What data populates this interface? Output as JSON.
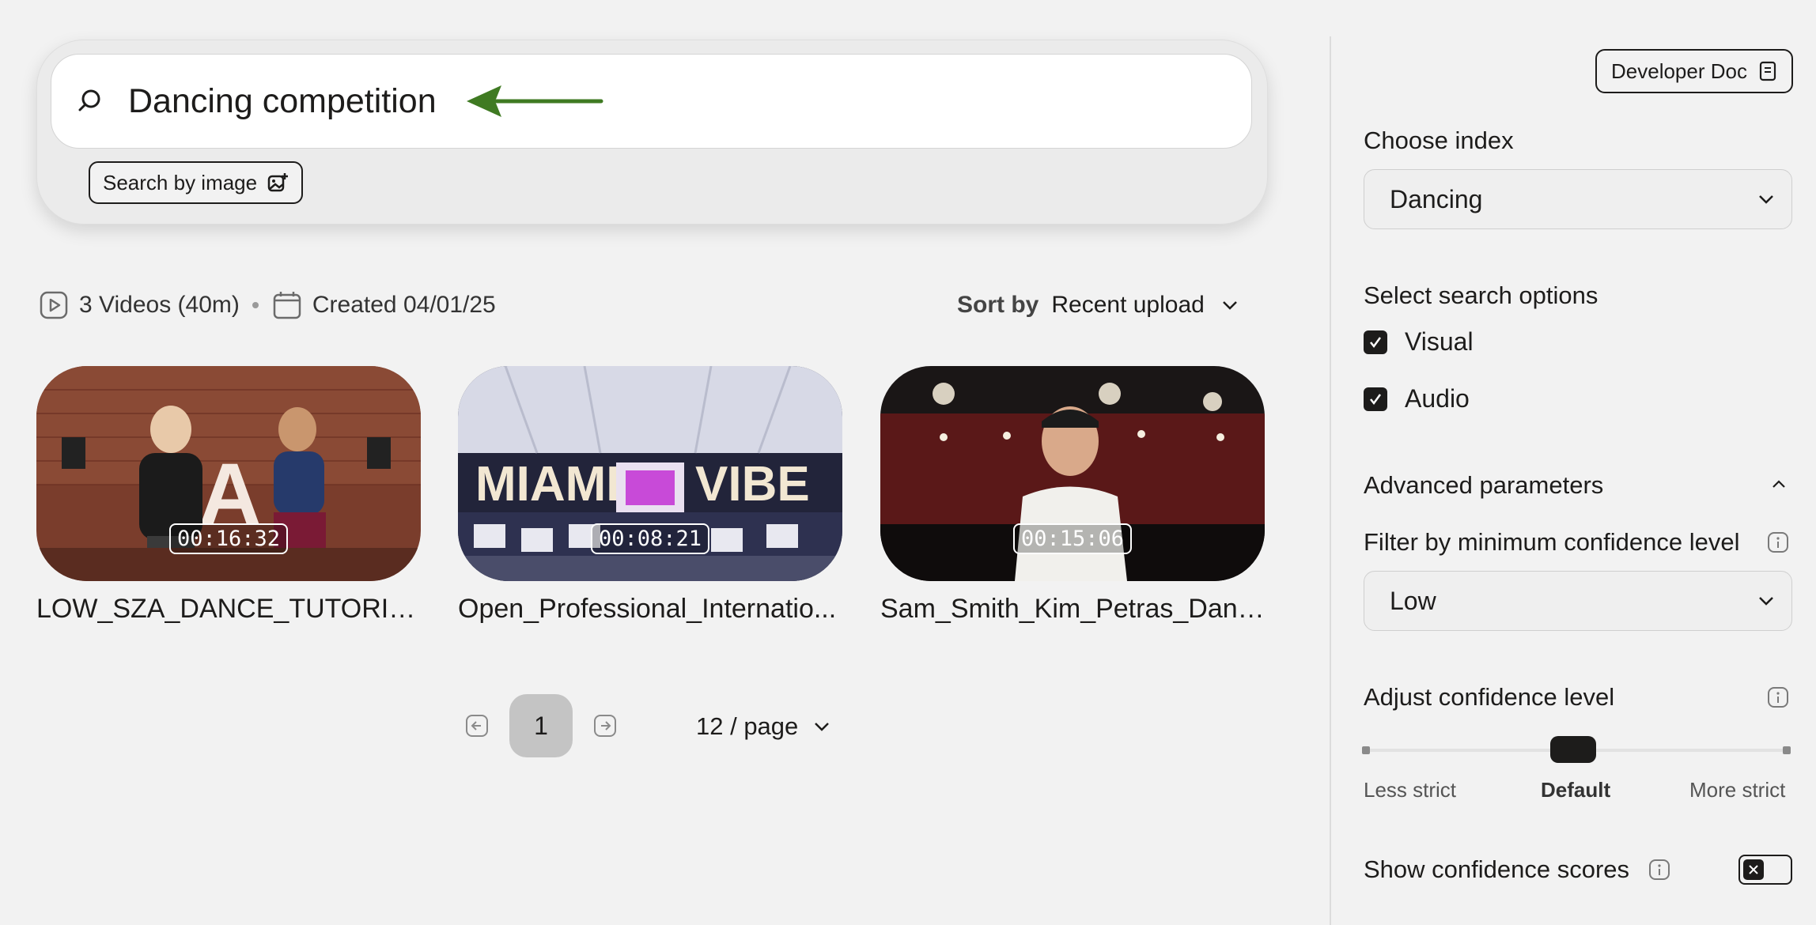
{
  "search": {
    "query": "Dancing competition",
    "image_search_label": "Search by image"
  },
  "meta": {
    "video_count": "3 Videos (40m)",
    "created": "Created 04/01/25"
  },
  "sort": {
    "label": "Sort by",
    "value": "Recent upload"
  },
  "videos": [
    {
      "title": "LOW_SZA_DANCE_TUTORIA...",
      "duration": "00:16:32"
    },
    {
      "title": "Open_Professional_Internatio...",
      "duration": "00:08:21"
    },
    {
      "title": "Sam_Smith_Kim_Petras_Danc...",
      "duration": "00:15:06"
    }
  ],
  "pagination": {
    "current_page": "1",
    "per_page": "12 / page"
  },
  "sidebar": {
    "developer_doc": "Developer Doc",
    "choose_index_label": "Choose index",
    "index_value": "Dancing",
    "search_options_label": "Select search options",
    "options": [
      {
        "label": "Visual",
        "checked": true
      },
      {
        "label": "Audio",
        "checked": true
      }
    ],
    "advanced_label": "Advanced parameters",
    "min_confidence_label": "Filter by minimum confidence level",
    "min_confidence_value": "Low",
    "adjust_confidence_label": "Adjust confidence level",
    "slider": {
      "left_label": "Less strict",
      "center_label": "Default",
      "right_label": "More strict"
    },
    "show_scores_label": "Show confidence scores",
    "show_scores_on": false
  },
  "colors": {
    "arrow": "#3f7a22",
    "text": "#1d1c1b",
    "background": "#f2f2f2"
  }
}
